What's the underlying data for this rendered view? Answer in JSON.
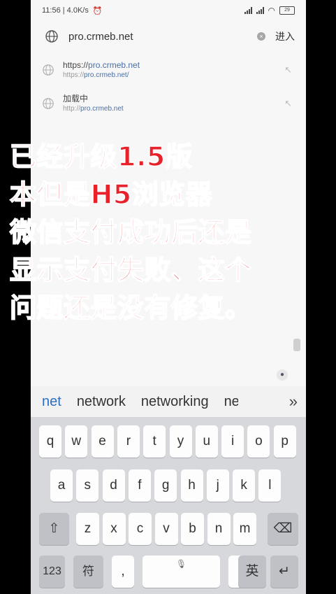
{
  "status_bar": {
    "time_speed": "11:56 | 4.0K/s",
    "battery": "29"
  },
  "address_bar": {
    "url": "pro.crmeb.net",
    "enter_label": "进入"
  },
  "suggestions": [
    {
      "title_prefix": "https://",
      "title_highlight": "pro.crmeb.net",
      "url_prefix": "https://",
      "url_highlight": "pro.crmeb.net/"
    },
    {
      "title_prefix": "加载中",
      "title_highlight": "",
      "url_prefix": "http://",
      "url_highlight": "pro.crmeb.net"
    }
  ],
  "overlay_lines": [
    "已经升级1.5版",
    "本但是H5浏览器",
    "微信支付成功后还是",
    "显示支付失败、这个",
    "问题还是没有修复。"
  ],
  "candidates": [
    "net",
    "network",
    "networking",
    "ne"
  ],
  "keyboard": {
    "row1": [
      "q",
      "w",
      "e",
      "r",
      "t",
      "y",
      "u",
      "i",
      "o",
      "p"
    ],
    "row2": [
      "a",
      "s",
      "d",
      "f",
      "g",
      "h",
      "j",
      "k",
      "l"
    ],
    "row3": [
      "z",
      "x",
      "c",
      "v",
      "b",
      "n",
      "m"
    ],
    "num_label": "123",
    "sym_label": "符",
    "comma": ",",
    "period": ".",
    "lang_label": "英"
  }
}
